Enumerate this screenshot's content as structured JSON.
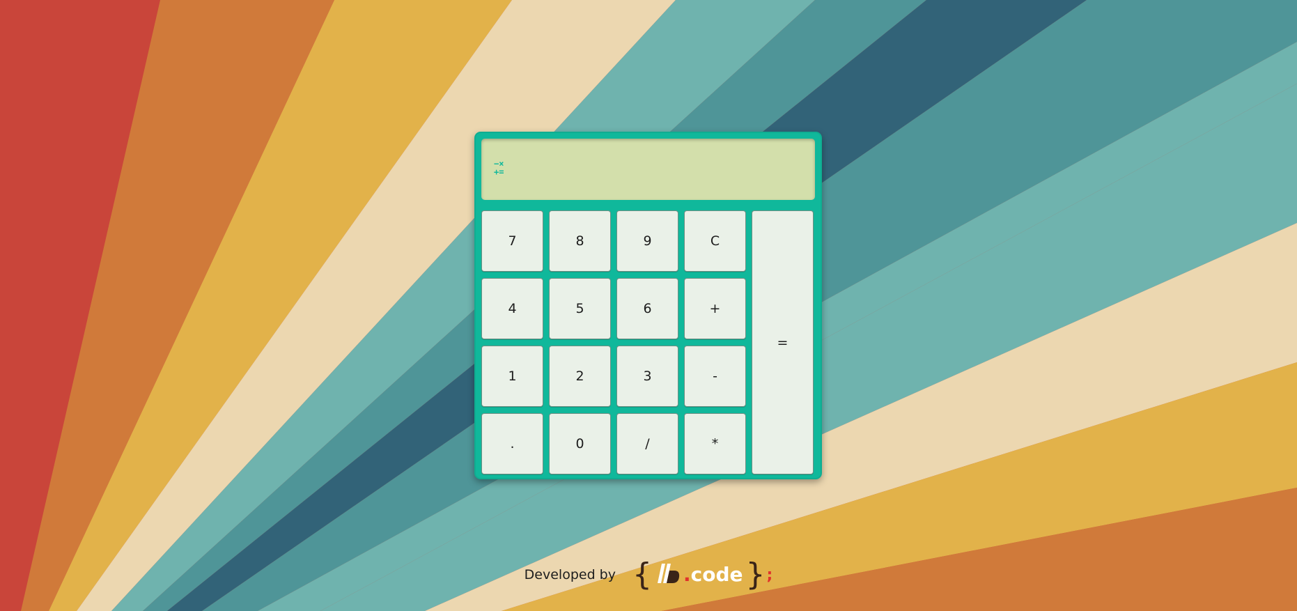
{
  "background": {
    "colors": [
      "#c9453a",
      "#d07a3a",
      "#e2b24a",
      "#ecd7b0",
      "#6fb3ae",
      "#4f9598",
      "#326378"
    ]
  },
  "calculator": {
    "body_color": "#10b89b",
    "display": {
      "background": "#d3dfab",
      "icon": "math-operators-icon",
      "icon_glyph_top": "−×",
      "icon_glyph_bottom": "+=",
      "value": ""
    },
    "keys": [
      {
        "label": "7",
        "name": "key-7"
      },
      {
        "label": "8",
        "name": "key-8"
      },
      {
        "label": "9",
        "name": "key-9"
      },
      {
        "label": "C",
        "name": "clear-button"
      },
      {
        "label": "4",
        "name": "key-4"
      },
      {
        "label": "5",
        "name": "key-5"
      },
      {
        "label": "6",
        "name": "key-6"
      },
      {
        "label": "+",
        "name": "add-button"
      },
      {
        "label": "1",
        "name": "key-1"
      },
      {
        "label": "2",
        "name": "key-2"
      },
      {
        "label": "3",
        "name": "key-3"
      },
      {
        "label": "-",
        "name": "subtract-button"
      },
      {
        "label": ".",
        "name": "decimal-button"
      },
      {
        "label": "0",
        "name": "key-0"
      },
      {
        "label": "/",
        "name": "divide-button"
      },
      {
        "label": "*",
        "name": "multiply-button"
      }
    ],
    "equals_label": "="
  },
  "footer": {
    "developed_by": "Developed by",
    "logo": {
      "brace_open": "{",
      "dot": ".",
      "word": "code",
      "brace_close": "}",
      "semicolon": ";"
    }
  }
}
